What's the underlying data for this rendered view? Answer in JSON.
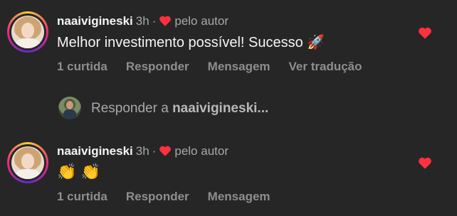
{
  "comments": [
    {
      "username": "naaivigineski",
      "time": "3h",
      "author_badge": "pelo autor",
      "text": "Melhor investimento possível! Sucesso 🚀",
      "likes": "1 curtida",
      "reply": "Responder",
      "message": "Mensagem",
      "translate": "Ver tradução"
    },
    {
      "username": "naaivigineski",
      "time": "3h",
      "author_badge": "pelo autor",
      "text": "👏 👏",
      "likes": "1 curtida",
      "reply": "Responder",
      "message": "Mensagem"
    }
  ],
  "reply_box": {
    "prefix": "Responder a ",
    "target": "naaivigineski..."
  },
  "colors": {
    "background": "#262626",
    "heart": "#ff3040",
    "muted": "#a8a8a8",
    "action": "#8e8e8e"
  },
  "icons": {
    "author_heart": "heart-icon",
    "like": "heart-icon"
  }
}
